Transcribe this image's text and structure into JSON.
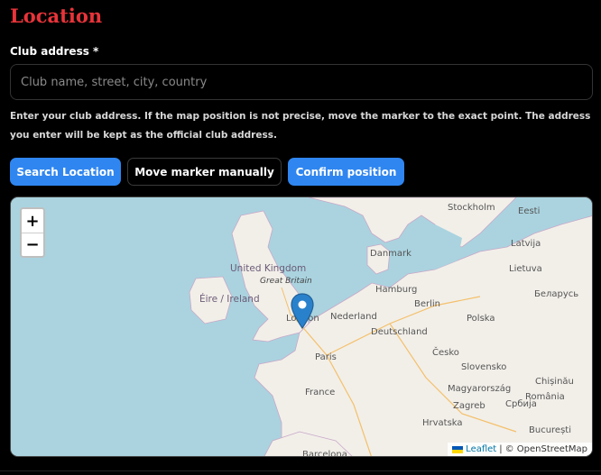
{
  "section": {
    "title": "Location"
  },
  "address": {
    "label": "Club address *",
    "placeholder": "Club name, street, city, country",
    "value": "",
    "help": "Enter your club address. If the map position is not precise, move the marker to the exact point. The address you enter will be kept as the official club address."
  },
  "buttons": {
    "search": "Search Location",
    "move": "Move marker manually",
    "confirm": "Confirm position"
  },
  "map": {
    "zoom_in": "+",
    "zoom_out": "−",
    "labels": {
      "stockholm": "Stockholm",
      "eesti": "Eesti",
      "latvija": "Latvija",
      "lietuva": "Lietuva",
      "danmark": "Danmark",
      "united_kingdom": "United Kingdom",
      "great_britain": "Great Britain",
      "eire": "Éire / Ireland",
      "hamburg": "Hamburg",
      "berlin": "Berlin",
      "belarus": "Беларусь",
      "london": "London",
      "nederland": "Nederland",
      "polska": "Polska",
      "deutschland": "Deutschland",
      "paris": "Paris",
      "cesko": "Česko",
      "slovensko": "Slovensko",
      "france": "France",
      "magyarorszag": "Magyarország",
      "chisinau": "Chișinău",
      "romania": "România",
      "zagreb": "Zagreb",
      "srbija": "Србија",
      "hrvatska": "Hrvatska",
      "bucuresti": "București",
      "barcelona": "Barcelona"
    },
    "attribution": {
      "leaflet": "Leaflet",
      "separator": "|",
      "osm": "© OpenStreetMap"
    }
  }
}
